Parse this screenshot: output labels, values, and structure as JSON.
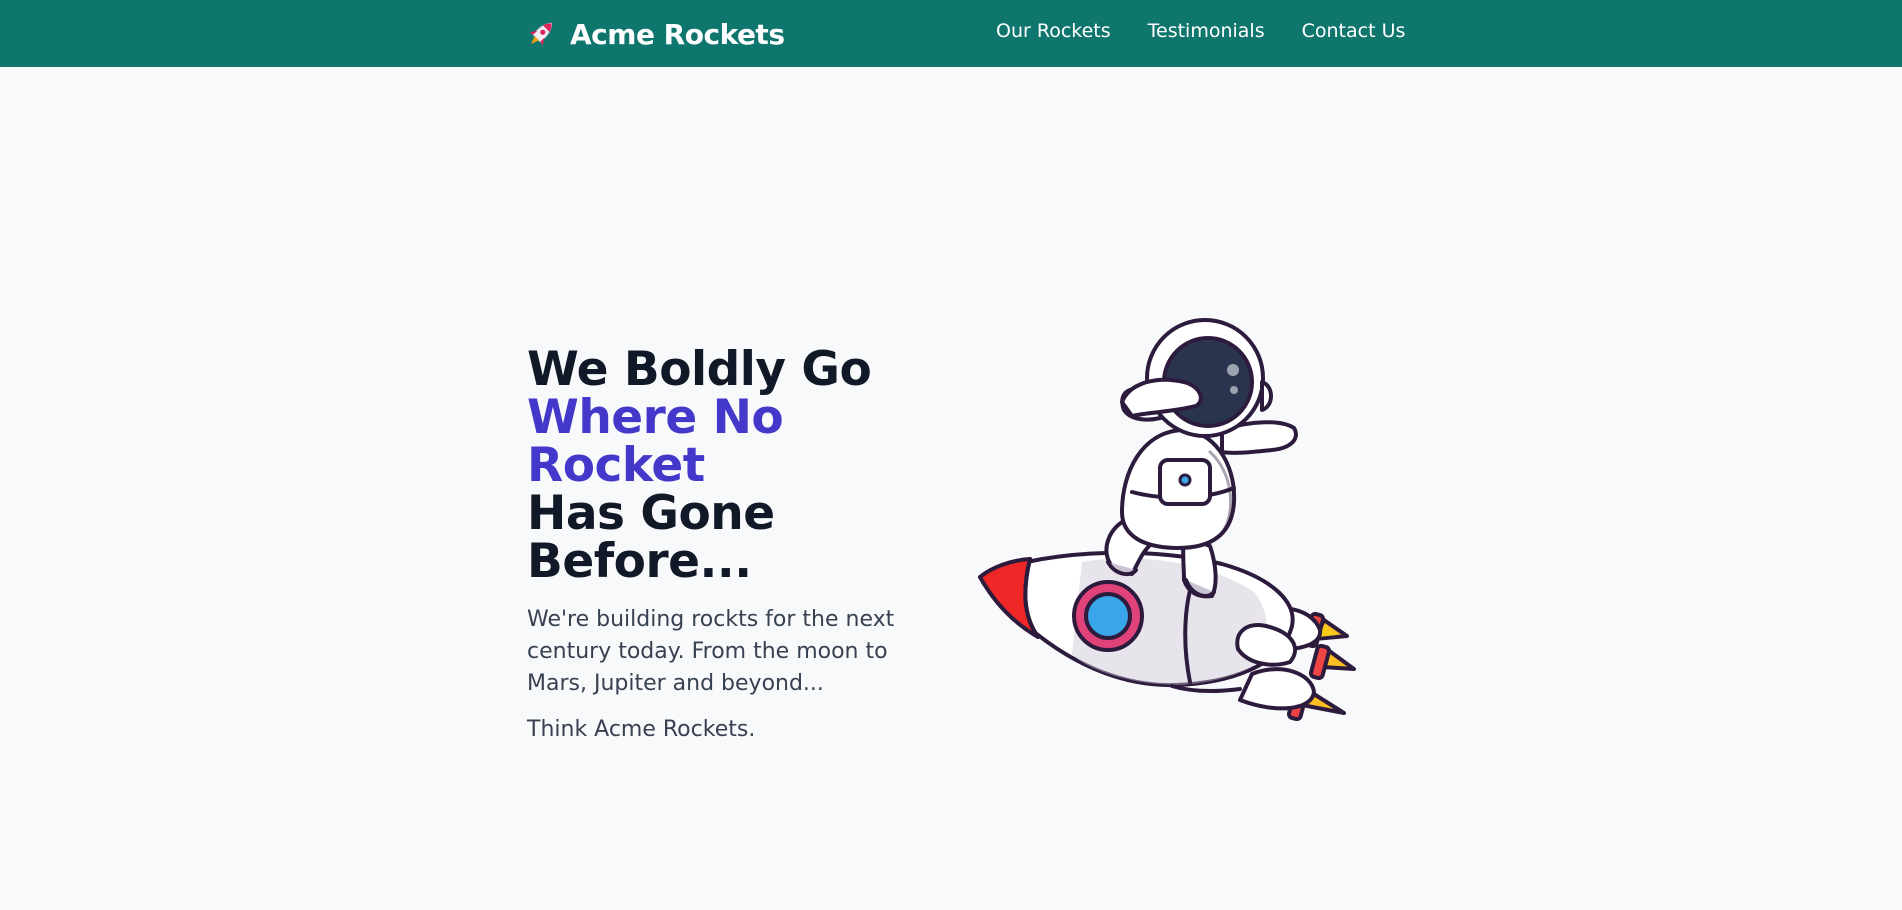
{
  "nav": {
    "brand": {
      "name": "Acme Rockets",
      "icon": "rocket-icon"
    },
    "links": [
      {
        "label": "Our Rockets"
      },
      {
        "label": "Testimonials"
      },
      {
        "label": "Contact Us"
      }
    ]
  },
  "hero": {
    "headline": [
      "We Boldly Go",
      "Where No Rocket",
      "Has Gone",
      "Before..."
    ],
    "description": "We're building rockts for the next century today. From the moon to Mars, Jupiter and beyond...",
    "tagline": "Think Acme Rockets.",
    "illustration": "astronaut-riding-rocket"
  },
  "colors": {
    "navbar": "#0f766e",
    "background": "#f8f9fb",
    "heading": "#111827",
    "accent": "#4338ca",
    "body_text": "#374151"
  }
}
